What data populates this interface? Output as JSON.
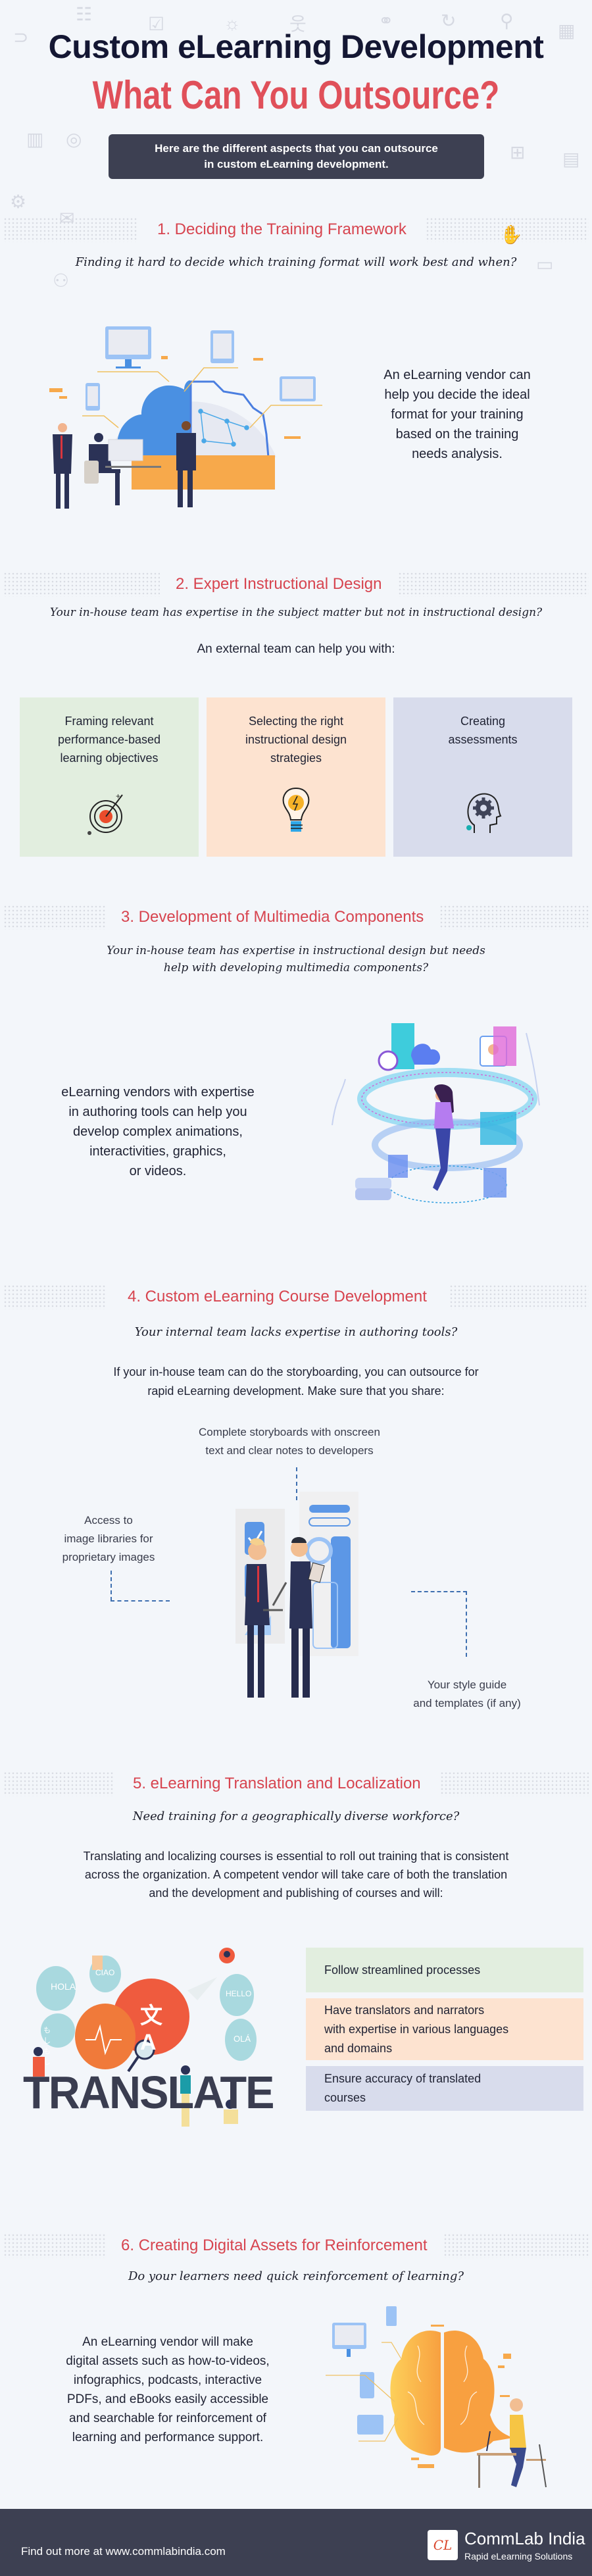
{
  "header": {
    "title": "Custom eLearning Development",
    "subtitle": "What Can You Outsource?",
    "intro_line1": "Here are the different aspects that you can outsource",
    "intro_line2": "in custom eLearning development."
  },
  "sections": [
    {
      "title": "1. Deciding the Training Framework",
      "question": "Finding it hard to decide which training format will work best and when?",
      "body_lines": [
        "An eLearning vendor can",
        "help you decide the ideal",
        "format for your training",
        "based on the training",
        "needs analysis."
      ]
    },
    {
      "title": "2. Expert Instructional Design",
      "question": "Your in-house team has expertise in the subject matter but not in instructional design?",
      "lead": "An external team can help you with:",
      "cards": [
        {
          "lines": [
            "Framing relevant",
            "performance-based",
            "learning objectives"
          ],
          "icon": "target-icon",
          "bg": "#e2eedf"
        },
        {
          "lines": [
            "Selecting the right",
            "instructional design",
            "strategies"
          ],
          "icon": "lightbulb-icon",
          "bg": "#fde3d0"
        },
        {
          "lines": [
            "Creating",
            "assessments"
          ],
          "icon": "head-gear-icon",
          "bg": "#d8dcec"
        }
      ]
    },
    {
      "title": "3. Development of Multimedia Components",
      "question_lines": [
        "Your in-house team has expertise in instructional design but needs",
        "help with developing multimedia components?"
      ],
      "body_lines": [
        "eLearning vendors with expertise",
        "in authoring tools can help you",
        "develop complex animations,",
        "interactivities, graphics,",
        "or videos."
      ]
    },
    {
      "title": "4. Custom eLearning Course Development",
      "question": "Your internal team lacks expertise in authoring tools?",
      "body_lines": [
        "If your in-house team can do the storyboarding, you can outsource for",
        "rapid eLearning development. Make sure that you share:"
      ],
      "callouts": {
        "top": [
          "Complete storyboards with onscreen",
          "text and clear notes to developers"
        ],
        "left": [
          "Access to",
          "image libraries for",
          "proprietary images"
        ],
        "right": [
          "Your style guide",
          "and templates (if any)"
        ]
      }
    },
    {
      "title": "5. eLearning Translation and Localization",
      "question": "Need training for a geographically diverse workforce?",
      "body_lines": [
        "Translating and localizing courses is essential to roll out training that is consistent",
        "across the organization. A competent vendor will take care of both the translation",
        "and the development and publishing of courses and will:"
      ],
      "illustration_word": "TRANSLATE",
      "bubbles": [
        "HOLA",
        "CIAO",
        "HELLO",
        "もしもし",
        "OLÁ",
        "文A"
      ],
      "bullets": [
        {
          "lines": [
            "Follow streamlined processes"
          ],
          "bg": "#e2eedf"
        },
        {
          "lines": [
            "Have translators and narrators",
            "with expertise in various languages",
            "and domains"
          ],
          "bg": "#fde3d0"
        },
        {
          "lines": [
            "Ensure accuracy of translated",
            "courses"
          ],
          "bg": "#d8dcec"
        }
      ]
    },
    {
      "title": "6. Creating Digital Assets for Reinforcement",
      "question": "Do your learners need quick reinforcement of learning?",
      "body_lines": [
        "An eLearning vendor will make",
        "digital assets such as how-to-videos,",
        "infographics, podcasts, interactive",
        "PDFs, and eBooks easily accessible",
        "and searchable for reinforcement of",
        "learning and performance support."
      ]
    }
  ],
  "footer": {
    "text": "Find out more at www.commlabindia.com",
    "logo_mark": "CL",
    "brand": "CommLab India",
    "tagline": "Rapid eLearning Solutions"
  },
  "colors": {
    "accent_red": "#d7444f",
    "title_navy": "#141733",
    "box_dark": "#3d4052",
    "background": "#f3f6fa"
  }
}
